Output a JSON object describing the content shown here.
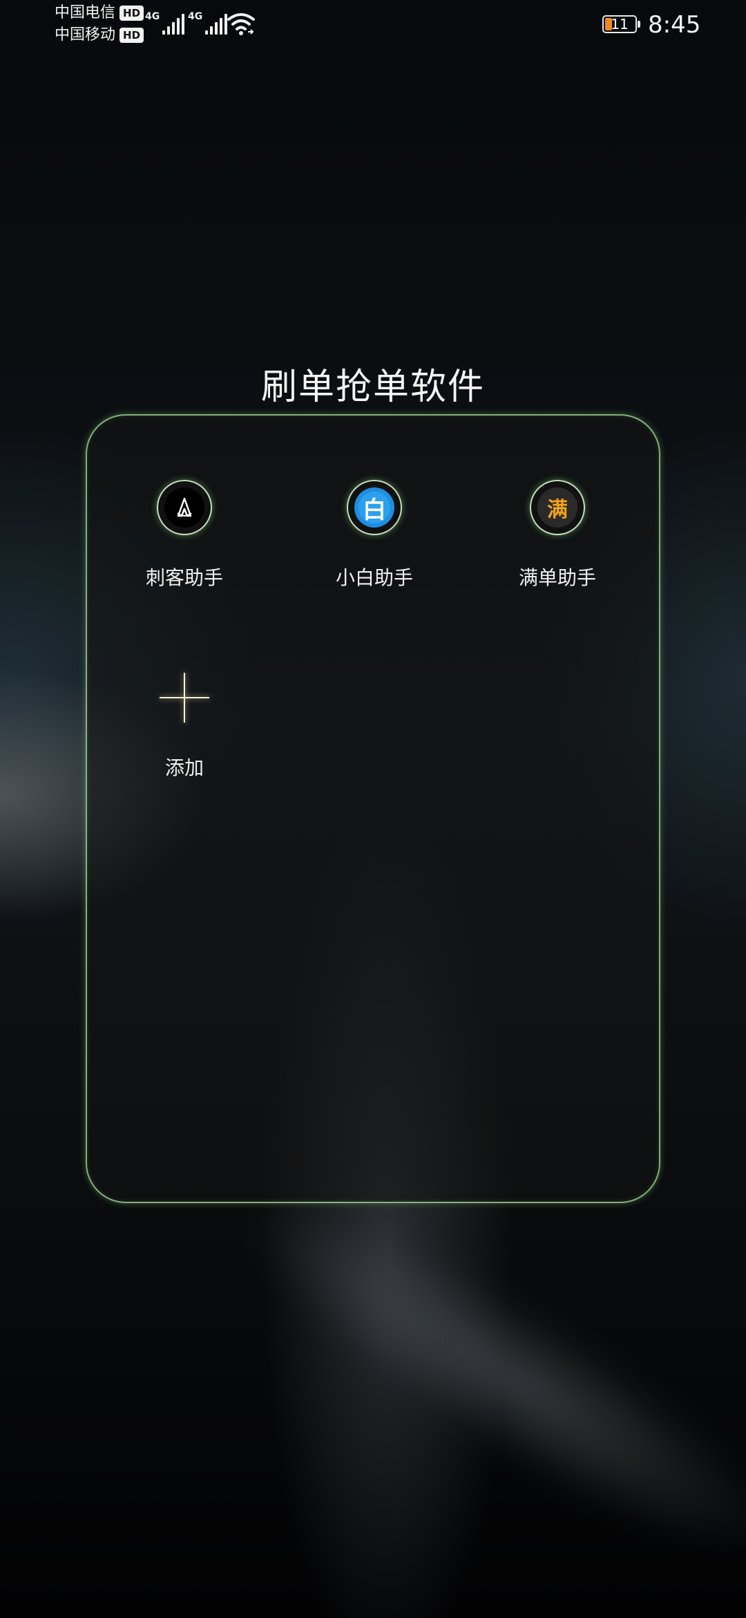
{
  "status_bar": {
    "carriers": [
      {
        "name": "中国电信",
        "badge": "HD"
      },
      {
        "name": "中国移动",
        "badge": "HD"
      }
    ],
    "network": [
      "4G",
      "4G"
    ],
    "battery_level": "11",
    "battery_color": "#f08a1c",
    "time": "8:45"
  },
  "folder": {
    "title": "刷单抢单软件",
    "border_color": "#aae6a0",
    "apps": [
      {
        "label": "刺客助手",
        "icon": "assassin-logo-icon"
      },
      {
        "label": "小白助手",
        "icon": "xiaobai-logo-icon",
        "glyph": "白"
      },
      {
        "label": "满单助手",
        "icon": "mandan-logo-icon",
        "glyph": "满"
      }
    ],
    "add_label": "添加"
  }
}
